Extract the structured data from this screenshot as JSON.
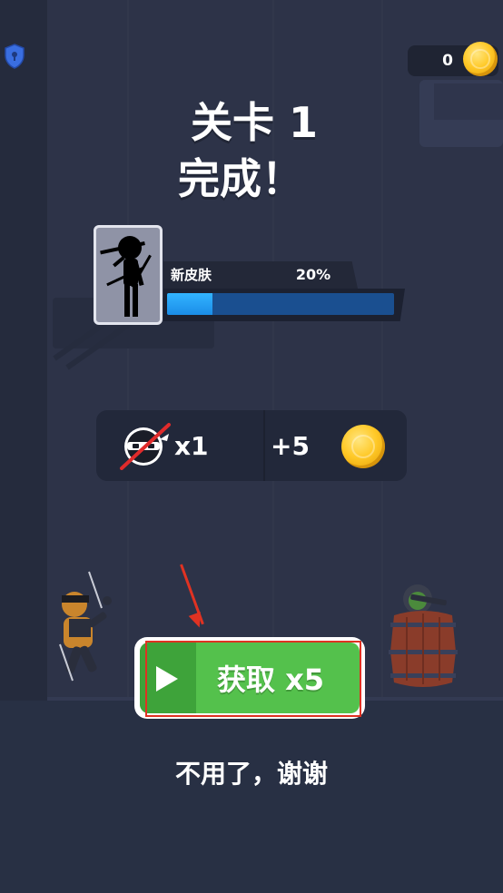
{
  "hud": {
    "coin_count": "0",
    "shield_icon": "shield-lock-icon",
    "coin_icon": "gold-coin-icon"
  },
  "result": {
    "title_line1": "关卡 1",
    "title_line2": "完成！"
  },
  "skin_progress": {
    "label": "新皮肤",
    "percent_text": "20%",
    "progress": 0.2,
    "fill_color": "#2fa8f8"
  },
  "rewards": {
    "kills_text": "x1",
    "coins_text": "+5",
    "kill_icon": "ninja-head-crossed-icon",
    "coin_icon": "gold-coin-icon"
  },
  "claim_button": {
    "label": "获取 x5",
    "icon": "play-video-icon",
    "color": "#54c14c"
  },
  "decline": {
    "label": "不用了，谢谢"
  },
  "annotation": {
    "highlight_color": "#e03222"
  }
}
